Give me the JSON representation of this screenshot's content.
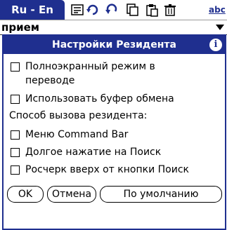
{
  "toolbar": {
    "lang_pair": "Ru - En",
    "icons": [
      "dictionary-icon",
      "refresh-icon",
      "undo-icon",
      "copy-icon",
      "paste-icon",
      "trash-icon"
    ],
    "abc_label": "abc"
  },
  "search": {
    "value": "прием"
  },
  "dialog": {
    "title": "Настройки Резидента",
    "options": [
      {
        "label": "Полноэкранный режим в переводе",
        "checked": false
      },
      {
        "label": "Использовать буфер обмена",
        "checked": false
      }
    ],
    "section_label": "Способ вызова резидента:",
    "methods": [
      {
        "label": "Меню Command Bar",
        "checked": false
      },
      {
        "label": "Долгое нажатие на Поиск",
        "checked": false
      },
      {
        "label": "Росчерк вверх от кнопки Поиск",
        "checked": false
      }
    ],
    "buttons": {
      "ok": "OK",
      "cancel": "Отмена",
      "default": "По умолчанию"
    }
  },
  "colors": {
    "accent": "#1f2f8f"
  }
}
